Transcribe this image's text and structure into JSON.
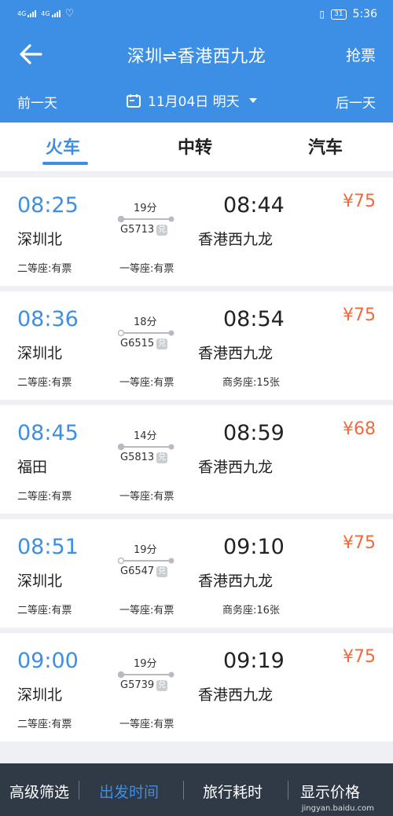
{
  "status_bar": {
    "signal1": "4G",
    "signal2": "4G",
    "battery": "31",
    "time": "5:36"
  },
  "header": {
    "title": "深圳⇌香港西九龙",
    "right_button": "抢票"
  },
  "date_bar": {
    "prev": "前一天",
    "date": "11月04日 明天",
    "next": "后一天"
  },
  "tabs": [
    {
      "label": "火车",
      "active": true
    },
    {
      "label": "中转",
      "active": false
    },
    {
      "label": "汽车",
      "active": false
    }
  ],
  "trains": [
    {
      "dep_time": "08:25",
      "dep_station": "深圳北",
      "duration": "19分",
      "train_no": "G5713",
      "arr_time": "08:44",
      "arr_station": "香港西九龙",
      "price": "¥75",
      "seat1": "二等座:有票",
      "seat2": "一等座:有票",
      "seat3": ""
    },
    {
      "dep_time": "08:36",
      "dep_station": "深圳北",
      "duration": "18分",
      "train_no": "G6515",
      "arr_time": "08:54",
      "arr_station": "香港西九龙",
      "price": "¥75",
      "seat1": "二等座:有票",
      "seat2": "一等座:有票",
      "seat3": "商务座:15张"
    },
    {
      "dep_time": "08:45",
      "dep_station": "福田",
      "duration": "14分",
      "train_no": "G5813",
      "arr_time": "08:59",
      "arr_station": "香港西九龙",
      "price": "¥68",
      "seat1": "二等座:有票",
      "seat2": "一等座:有票",
      "seat3": ""
    },
    {
      "dep_time": "08:51",
      "dep_station": "深圳北",
      "duration": "19分",
      "train_no": "G6547",
      "arr_time": "09:10",
      "arr_station": "香港西九龙",
      "price": "¥75",
      "seat1": "二等座:有票",
      "seat2": "一等座:有票",
      "seat3": "商务座:16张"
    },
    {
      "dep_time": "09:00",
      "dep_station": "深圳北",
      "duration": "19分",
      "train_no": "G5739",
      "arr_time": "09:19",
      "arr_station": "香港西九龙",
      "price": "¥75",
      "seat1": "二等座:有票",
      "seat2": "一等座:有票",
      "seat3": ""
    }
  ],
  "exchange_badge": "兑",
  "bottom_bar": {
    "filter": "高级筛选",
    "depart_time": "出发时间",
    "travel_time": "旅行耗时",
    "price": "显示价格"
  },
  "watermark": "jingyan.baidu.com",
  "colors": {
    "primary": "#3d8fe6",
    "price": "#f06a3c",
    "bottom_bar": "#2f3a46"
  }
}
